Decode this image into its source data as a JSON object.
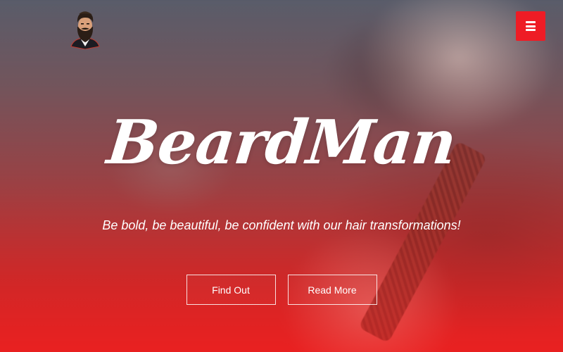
{
  "header": {
    "logo_icon": "bearded-man-logo-icon",
    "menu_icon": "hamburger-menu-icon",
    "menu_color": "#ee1c25"
  },
  "hero": {
    "title": "BeardMan",
    "tagline": "Be bold, be beautiful, be confident with our hair transformations!",
    "buttons": {
      "find_out": "Find Out",
      "read_more": "Read More"
    }
  }
}
